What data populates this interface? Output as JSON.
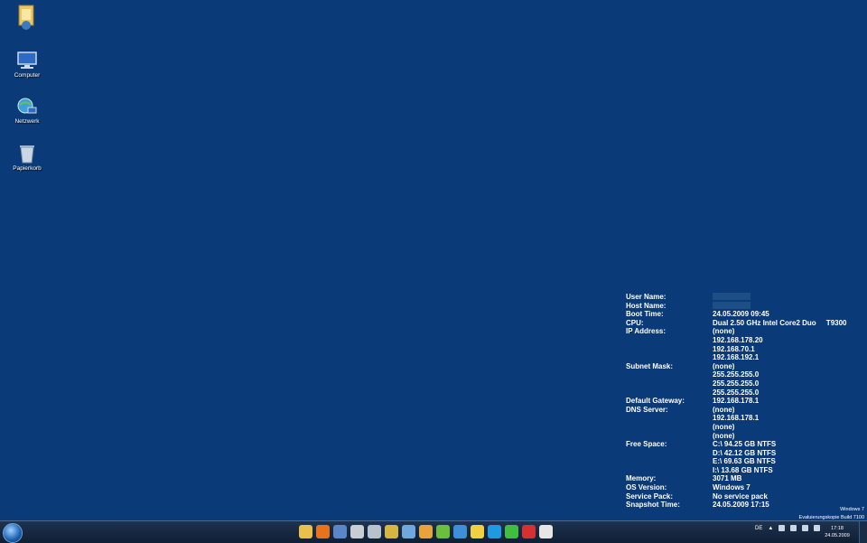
{
  "desktop": {
    "icons": [
      {
        "label": "",
        "icon": "user-folder-icon"
      },
      {
        "label": "Computer",
        "icon": "computer-icon"
      },
      {
        "label": "Netzwerk",
        "icon": "network-icon"
      },
      {
        "label": "Papierkorb",
        "icon": "recycle-bin-icon"
      }
    ]
  },
  "sysinfo": {
    "user_name_label": "User Name:",
    "host_name_label": "Host Name:",
    "boot_time_label": "Boot Time:",
    "boot_time": "24.05.2009 09:45",
    "cpu_label": "CPU:",
    "cpu": "Dual 2.50 GHz Intel Core2 Duo     T9300",
    "ip_label": "IP Address:",
    "ip": [
      "(none)",
      "192.168.178.20",
      "192.168.70.1",
      "192.168.192.1"
    ],
    "subnet_label": "Subnet Mask:",
    "subnet": [
      "(none)",
      "255.255.255.0",
      "255.255.255.0",
      "255.255.255.0"
    ],
    "gateway_label": "Default Gateway:",
    "gateway": "192.168.178.1",
    "dns_label": "DNS Server:",
    "dns": [
      "(none)",
      "192.168.178.1",
      "(none)",
      "(none)"
    ],
    "free_label": "Free Space:",
    "free": [
      "C:\\ 94.25 GB NTFS",
      "D:\\ 42.12 GB NTFS",
      "E:\\ 69.63 GB NTFS",
      "I:\\ 13.68 GB NTFS"
    ],
    "memory_label": "Memory:",
    "memory": "3071 MB",
    "os_label": "OS Version:",
    "os": "Windows 7",
    "sp_label": "Service Pack:",
    "sp": "No service pack",
    "snapshot_label": "Snapshot Time:",
    "snapshot": "24.05.2009 17:15"
  },
  "watermark": {
    "line1": "Windows 7",
    "line2": "Evaluierungskopie Build 7100"
  },
  "taskbar": {
    "pinned": [
      {
        "icon": "explorer-icon",
        "color": "#e8c04a"
      },
      {
        "icon": "firefox-icon",
        "color": "#e8731c"
      },
      {
        "icon": "network-monitor-icon",
        "color": "#5a86c8"
      },
      {
        "icon": "tool-icon",
        "color": "#c9cdd4"
      },
      {
        "icon": "satellite-icon",
        "color": "#b8c2cf"
      },
      {
        "icon": "archive-icon",
        "color": "#d4b640"
      },
      {
        "icon": "plane-icon",
        "color": "#6fa8dc"
      },
      {
        "icon": "media-player-icon",
        "color": "#e8a33a"
      },
      {
        "icon": "game-icon",
        "color": "#6bbf3a"
      },
      {
        "icon": "app-icon",
        "color": "#3f8fd6"
      },
      {
        "icon": "messenger-icon",
        "color": "#f0d040"
      },
      {
        "icon": "skype-icon",
        "color": "#1e9be0"
      },
      {
        "icon": "flower-icon",
        "color": "#3fbf3f"
      },
      {
        "icon": "poker-icon",
        "color": "#d83030"
      },
      {
        "icon": "terminal-icon",
        "color": "#e6e6e6"
      }
    ],
    "language": "DE",
    "time": "17:18",
    "date": "24.05.2009"
  }
}
